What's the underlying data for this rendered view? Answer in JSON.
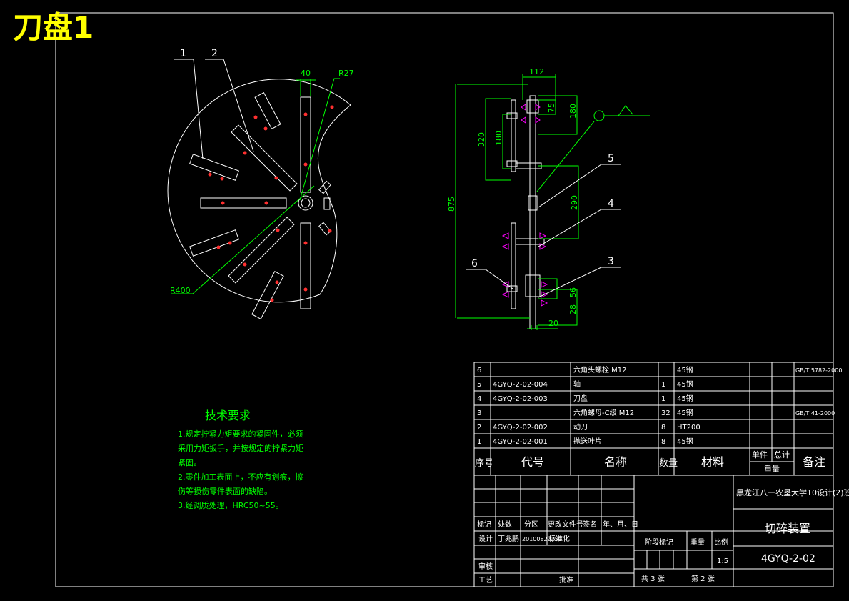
{
  "page_title": "刀盘1",
  "views": {
    "front": {
      "balloons": [
        "1",
        "2"
      ],
      "dims": {
        "width": "40",
        "radius_small": "R27",
        "radius_large": "R400"
      }
    },
    "side": {
      "balloons": [
        "5",
        "4",
        "3",
        "6"
      ],
      "dims": [
        "112",
        "75",
        "180",
        "320",
        "180",
        "875",
        "290",
        "56",
        "28",
        "20"
      ]
    }
  },
  "technical_requirements": {
    "title": "技术要求",
    "items": [
      "1.规定拧紧力矩要求的紧固件，必须",
      "采用力矩扳手，并按规定的拧紧力矩",
      "紧固。",
      "2.零件加工表面上，不应有划痕，擦",
      "伤等损伤零件表面的缺陷。",
      "3.经调质处理，HRC50~55。"
    ]
  },
  "parts_list": {
    "rows": [
      {
        "no": "6",
        "code": "",
        "name": "六角头螺栓 M12",
        "qty": "",
        "material": "45钢",
        "remark": "GB/T 5782-2000"
      },
      {
        "no": "5",
        "code": "4GYQ-2-02-004",
        "name": "轴",
        "qty": "1",
        "material": "45钢",
        "remark": ""
      },
      {
        "no": "4",
        "code": "4GYQ-2-02-003",
        "name": "刀盘",
        "qty": "1",
        "material": "45钢",
        "remark": ""
      },
      {
        "no": "3",
        "code": "",
        "name": "六角螺母-C级 M12",
        "qty": "32",
        "material": "45钢",
        "remark": "GB/T 41-2000"
      },
      {
        "no": "2",
        "code": "4GYQ-2-02-002",
        "name": "动刀",
        "qty": "8",
        "material": "HT200",
        "remark": ""
      },
      {
        "no": "1",
        "code": "4GYQ-2-02-001",
        "name": "抛送叶片",
        "qty": "8",
        "material": "45钢",
        "remark": ""
      }
    ],
    "header": {
      "no": "序号",
      "code": "代号",
      "name": "名称",
      "qty": "数量",
      "material": "材料",
      "unit": "单件",
      "total": "总计",
      "weight": "重量",
      "remark": "备注"
    }
  },
  "title_block": {
    "school": "黑龙江八一农垦大学10设计(2)班",
    "drawing_name": "切碎装置",
    "drawing_no": "4GYQ-2-02",
    "rev_headers": [
      "标记",
      "处数",
      "分区",
      "更改文件号",
      "签名",
      "年、月、日"
    ],
    "design_label": "设计",
    "designer": "丁兆鹏",
    "design_date": "20100820250",
    "standardization": "标准化",
    "review": "审核",
    "process": "工艺",
    "approve": "批准",
    "stage_mark": "阶段标记",
    "weight": "重量",
    "scale": "比例",
    "scale_value": "1:5",
    "sheets": "共  3  张",
    "sheet_no": "第  2  张"
  },
  "colors": {
    "background": "#000000",
    "outline": "#ffffff",
    "dimension": "#00ff00",
    "title": "#ffff00",
    "weld_symbol": "#ff00ff"
  }
}
